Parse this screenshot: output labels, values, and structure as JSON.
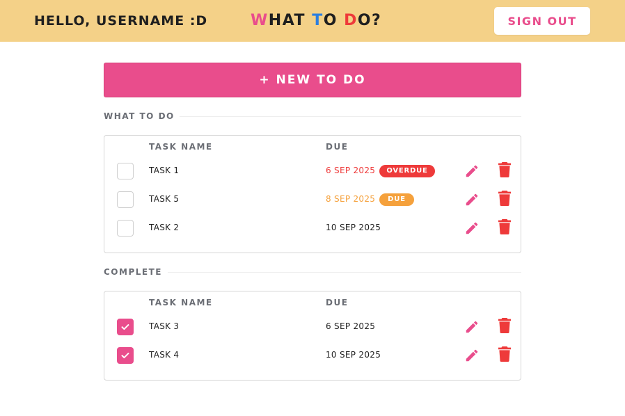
{
  "header": {
    "greeting": "HELLO, USERNAME :D",
    "title_letters": [
      {
        "char": "W",
        "color": "#e94d8c"
      },
      {
        "char": "HAT ",
        "color": "#1f1f1f"
      },
      {
        "char": "T",
        "color": "#2c7fe0"
      },
      {
        "char": "O ",
        "color": "#1f1f1f"
      },
      {
        "char": "D",
        "color": "#ee3a3a"
      },
      {
        "char": "O?",
        "color": "#1f1f1f"
      }
    ],
    "sign_out_label": "SIGN OUT"
  },
  "new_todo_label": "+ NEW TO DO",
  "todo_section": {
    "label": "WHAT TO DO",
    "columns": {
      "name": "TASK NAME",
      "due": "DUE"
    },
    "tasks": [
      {
        "name": "TASK 1",
        "due": "6 SEP 2025",
        "status": "OVERDUE",
        "checked": false
      },
      {
        "name": "TASK 5",
        "due": "8 SEP 2025",
        "status": "DUE",
        "checked": false
      },
      {
        "name": "TASK 2",
        "due": "10 SEP 2025",
        "status": "",
        "checked": false
      }
    ]
  },
  "complete_section": {
    "label": "COMPLETE",
    "columns": {
      "name": "TASK NAME",
      "due": "DUE"
    },
    "tasks": [
      {
        "name": "TASK 3",
        "due": "6 SEP 2025",
        "checked": true
      },
      {
        "name": "TASK 4",
        "due": "10 SEP 2025",
        "checked": true
      }
    ]
  },
  "colors": {
    "header_bg": "#f4d188",
    "accent": "#e94d8c",
    "overdue": "#ee3a3a",
    "due": "#f5a13c"
  },
  "icons": [
    "pencil-icon",
    "trash-icon",
    "check-icon"
  ]
}
